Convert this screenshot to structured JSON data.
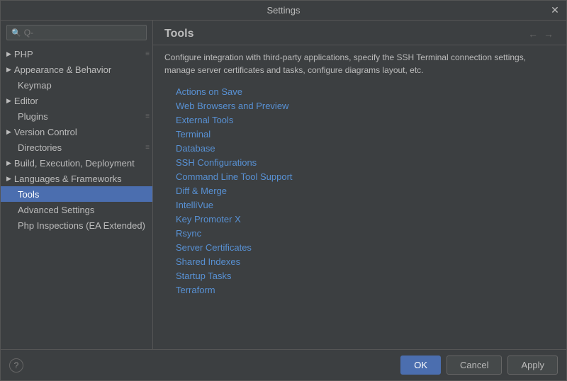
{
  "dialog": {
    "title": "Settings"
  },
  "sidebar": {
    "search_placeholder": "Q-",
    "items": [
      {
        "id": "php",
        "label": "PHP",
        "arrow": false,
        "has_expand": true,
        "indent": 0
      },
      {
        "id": "appearance-behavior",
        "label": "Appearance & Behavior",
        "arrow": true,
        "has_expand": false,
        "indent": 0
      },
      {
        "id": "keymap",
        "label": "Keymap",
        "arrow": false,
        "has_expand": false,
        "indent": 0
      },
      {
        "id": "editor",
        "label": "Editor",
        "arrow": true,
        "has_expand": false,
        "indent": 0
      },
      {
        "id": "plugins",
        "label": "Plugins",
        "arrow": false,
        "has_expand": true,
        "indent": 0
      },
      {
        "id": "version-control",
        "label": "Version Control",
        "arrow": true,
        "has_expand": false,
        "indent": 0
      },
      {
        "id": "directories",
        "label": "Directories",
        "arrow": false,
        "has_expand": true,
        "indent": 0
      },
      {
        "id": "build-execution-deployment",
        "label": "Build, Execution, Deployment",
        "arrow": true,
        "has_expand": false,
        "indent": 0
      },
      {
        "id": "languages-frameworks",
        "label": "Languages & Frameworks",
        "arrow": true,
        "has_expand": false,
        "indent": 0
      },
      {
        "id": "tools",
        "label": "Tools",
        "arrow": false,
        "has_expand": false,
        "indent": 0,
        "active": true
      },
      {
        "id": "advanced-settings",
        "label": "Advanced Settings",
        "arrow": false,
        "has_expand": false,
        "indent": 0
      },
      {
        "id": "php-inspections",
        "label": "Php Inspections (EA Extended)",
        "arrow": false,
        "has_expand": false,
        "indent": 0
      }
    ]
  },
  "content": {
    "title": "Tools",
    "description": "Configure integration with third-party applications, specify the SSH Terminal connection settings, manage server certificates and tasks, configure diagrams layout, etc.",
    "links": [
      {
        "id": "actions-on-save",
        "label": "Actions on Save"
      },
      {
        "id": "web-browsers-preview",
        "label": "Web Browsers and Preview"
      },
      {
        "id": "external-tools",
        "label": "External Tools"
      },
      {
        "id": "terminal",
        "label": "Terminal"
      },
      {
        "id": "database",
        "label": "Database"
      },
      {
        "id": "ssh-configurations",
        "label": "SSH Configurations"
      },
      {
        "id": "command-line-tool-support",
        "label": "Command Line Tool Support"
      },
      {
        "id": "diff-merge",
        "label": "Diff & Merge"
      },
      {
        "id": "intellivue",
        "label": "IntelliVue"
      },
      {
        "id": "key-promoter-x",
        "label": "Key Promoter X"
      },
      {
        "id": "rsync",
        "label": "Rsync"
      },
      {
        "id": "server-certificates",
        "label": "Server Certificates"
      },
      {
        "id": "shared-indexes",
        "label": "Shared Indexes"
      },
      {
        "id": "startup-tasks",
        "label": "Startup Tasks"
      },
      {
        "id": "terraform",
        "label": "Terraform"
      }
    ]
  },
  "footer": {
    "help_label": "?",
    "ok_label": "OK",
    "cancel_label": "Cancel",
    "apply_label": "Apply"
  }
}
